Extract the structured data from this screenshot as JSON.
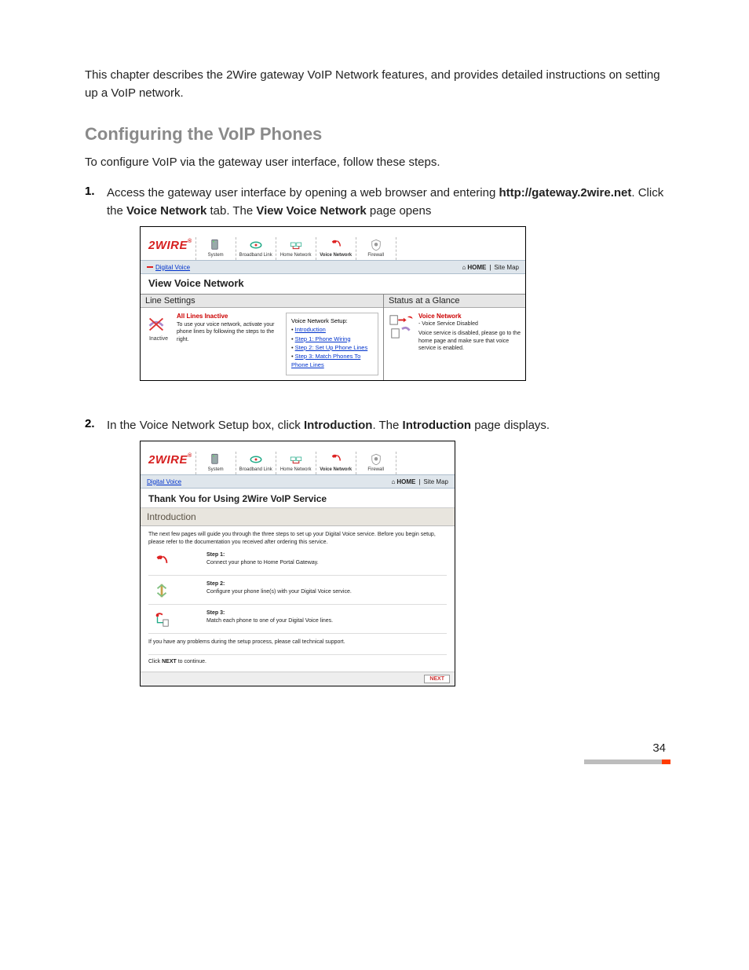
{
  "page": {
    "intro": "This chapter describes the 2Wire gateway VoIP Network features, and provides detailed instructions on setting up a VoIP network.",
    "heading": "Configuring the VoIP Phones",
    "lead": "To configure VoIP via the gateway user interface, follow these steps.",
    "pagenum": "34"
  },
  "steps": {
    "s1_num": "1.",
    "s1_a": "Access the gateway user interface by opening a web browser and entering ",
    "s1_b": "http://gateway.2wire.net",
    "s1_c": ". Click the ",
    "s1_d": "Voice Network",
    "s1_e": " tab. The ",
    "s1_f": "View Voice Network",
    "s1_g": " page opens",
    "s2_num": "2.",
    "s2_a": "In the Voice Network Setup box, click ",
    "s2_b": "Introduction",
    "s2_c": ". The ",
    "s2_d": "Introduction",
    "s2_e": " page displays."
  },
  "brand": {
    "logo": "2WIRE",
    "reg": "®"
  },
  "tabs": {
    "system": "System",
    "broadband": "Broadband Link",
    "home": "Home Network",
    "voice": "Voice Network",
    "firewall": "Firewall"
  },
  "subbar": {
    "digital": "Digital Voice",
    "home": "HOME",
    "sitemap": "Site Map"
  },
  "shot1": {
    "title": "View Voice Network",
    "line_settings": "Line Settings",
    "status_glance": "Status at a Glance",
    "all_inactive": "All Lines Inactive",
    "inactive_text": "To use your voice network, activate your phone lines by following the steps to the right.",
    "inactive_cap": "Inactive",
    "setup_title": "Voice Network Setup:",
    "setup_intro": "Introduction",
    "setup_s1": "Step 1: Phone Wiring",
    "setup_s2": "Step 2: Set Up Phone Lines",
    "setup_s3": "Step 3: Match Phones To Phone Lines",
    "vn_title": "Voice Network",
    "vn_sub": "- Voice Service Disabled",
    "vn_text": "Voice service is disabled, please go to the home page and make sure that voice service is enabled."
  },
  "shot2": {
    "thank": "Thank You for Using 2Wire VoIP Service",
    "intro": "Introduction",
    "lead": "The next few pages will guide you through the three steps to set up your Digital Voice service. Before you begin setup, please refer to the documentation you received after ordering this service.",
    "s1l": "Step 1:",
    "s1t": "Connect your phone to Home Portal Gateway.",
    "s2l": "Step 2:",
    "s2t": "Configure your phone line(s) with your Digital Voice service.",
    "s3l": "Step 3:",
    "s3t": "Match each phone to one of your Digital Voice lines.",
    "problems": "If you have any problems during the setup process, please call technical support.",
    "clicknext_a": "Click ",
    "clicknext_b": "NEXT",
    "clicknext_c": " to continue.",
    "next": "NEXT"
  }
}
